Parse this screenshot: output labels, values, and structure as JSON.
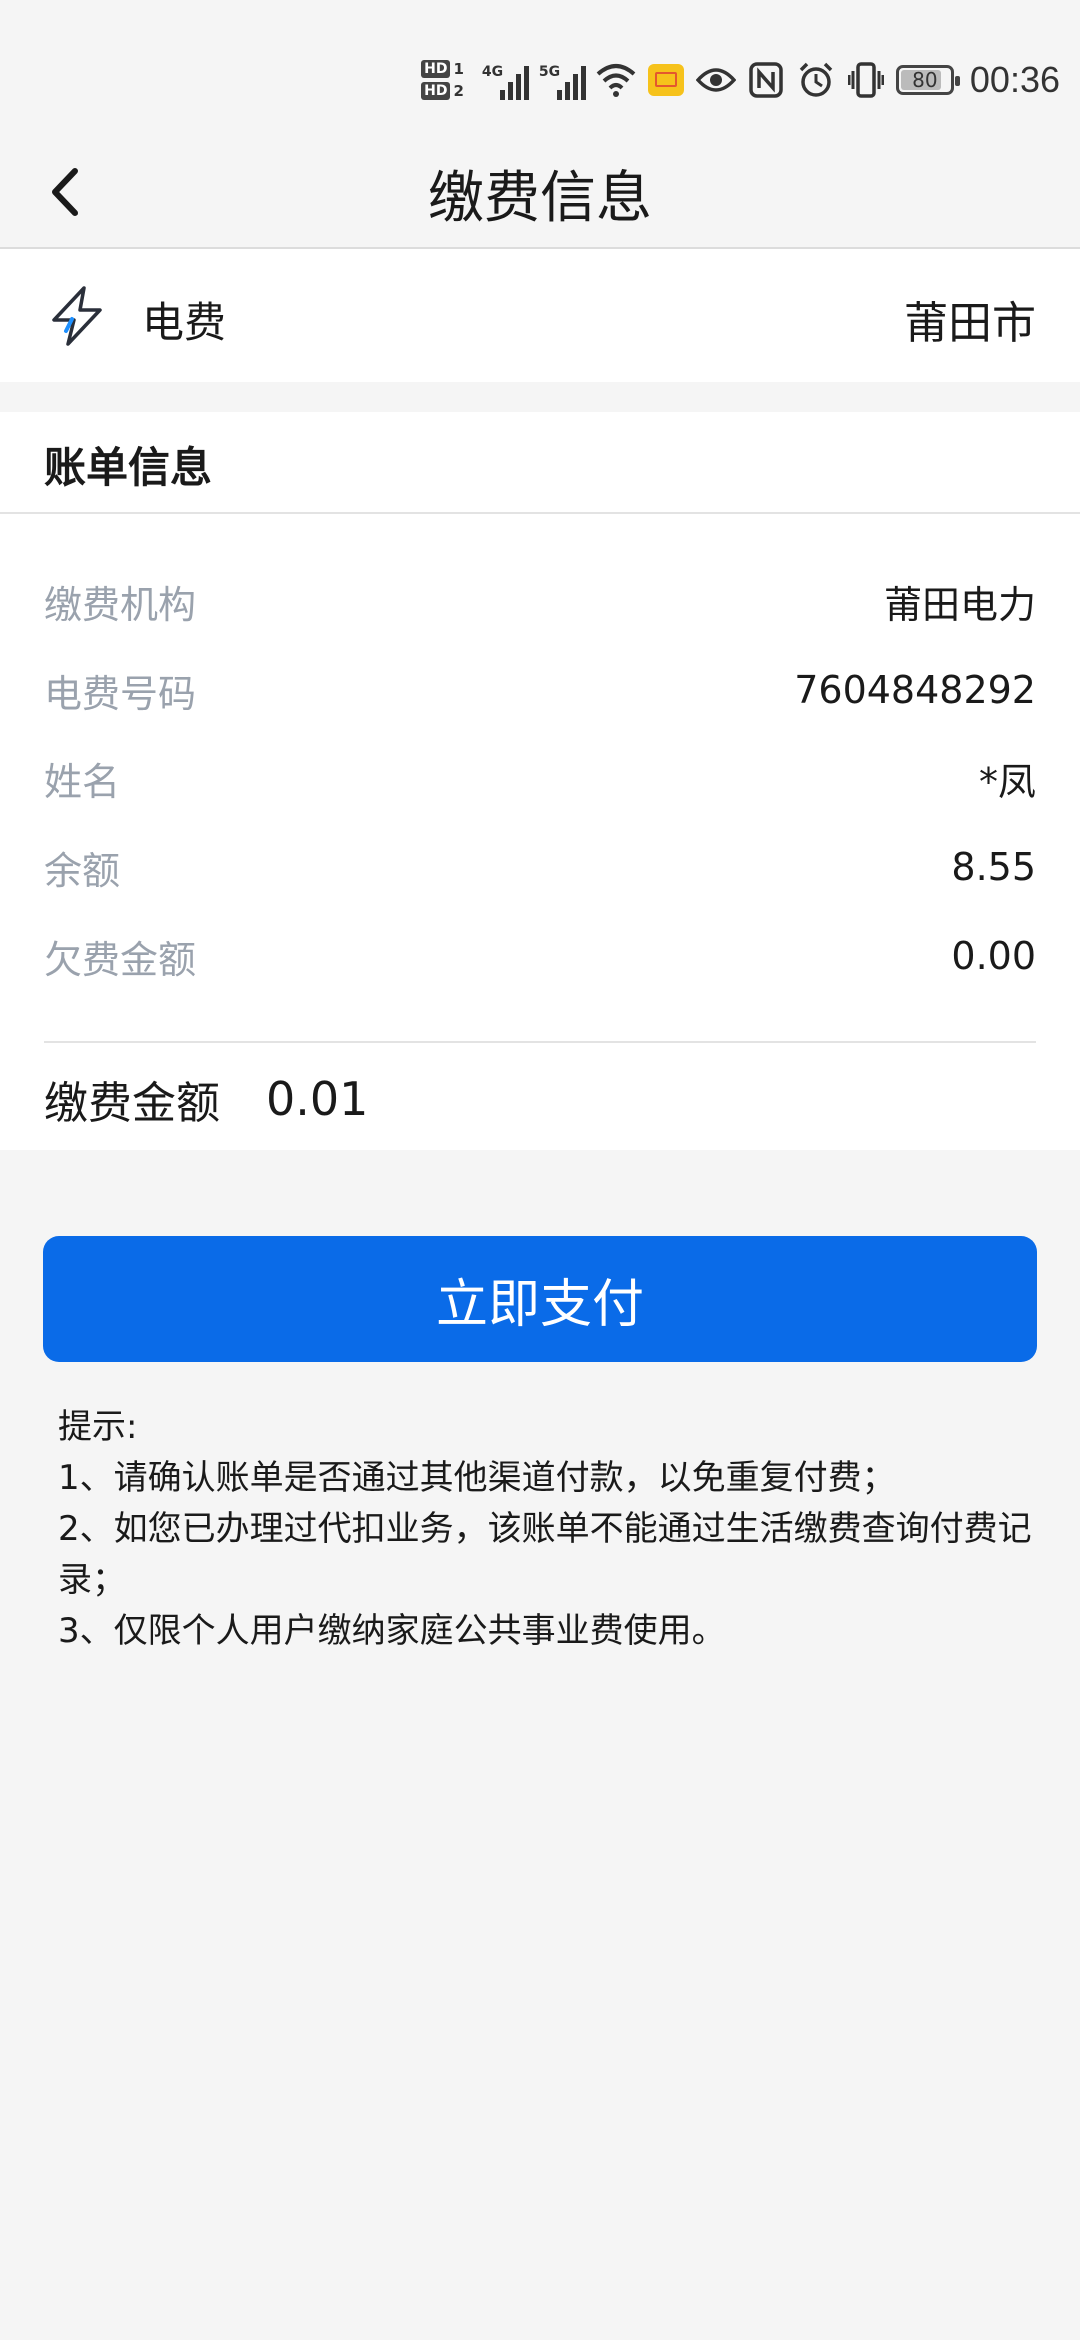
{
  "status_bar": {
    "hd1": "HD",
    "hd1_num": "1",
    "hd2": "HD",
    "hd2_num": "2",
    "net1": "4G",
    "net2": "5G",
    "battery": "80",
    "time": "00:36"
  },
  "header": {
    "title": "缴费信息"
  },
  "service": {
    "name": "电费",
    "city": "莆田市",
    "icon": "lightning-icon"
  },
  "bill": {
    "title": "账单信息",
    "rows": [
      {
        "label": "缴费机构",
        "value": "莆田电力"
      },
      {
        "label": "电费号码",
        "value": "7604848292"
      },
      {
        "label": "姓名",
        "value": "*凤"
      },
      {
        "label": "余额",
        "value": "8.55"
      },
      {
        "label": "欠费金额",
        "value": "0.00"
      }
    ],
    "amount_label": "缴费金额",
    "amount_value": "0.01"
  },
  "pay_button": {
    "label": "立即支付",
    "color": "#0a6be8"
  },
  "tips": {
    "title": "提示:",
    "lines": [
      "1、请确认账单是否通过其他渠道付款，以免重复付费；",
      "2、如您已办理过代扣业务，该账单不能通过生活缴费查询付费记录；",
      "3、仅限个人用户缴纳家庭公共事业费使用。"
    ]
  }
}
